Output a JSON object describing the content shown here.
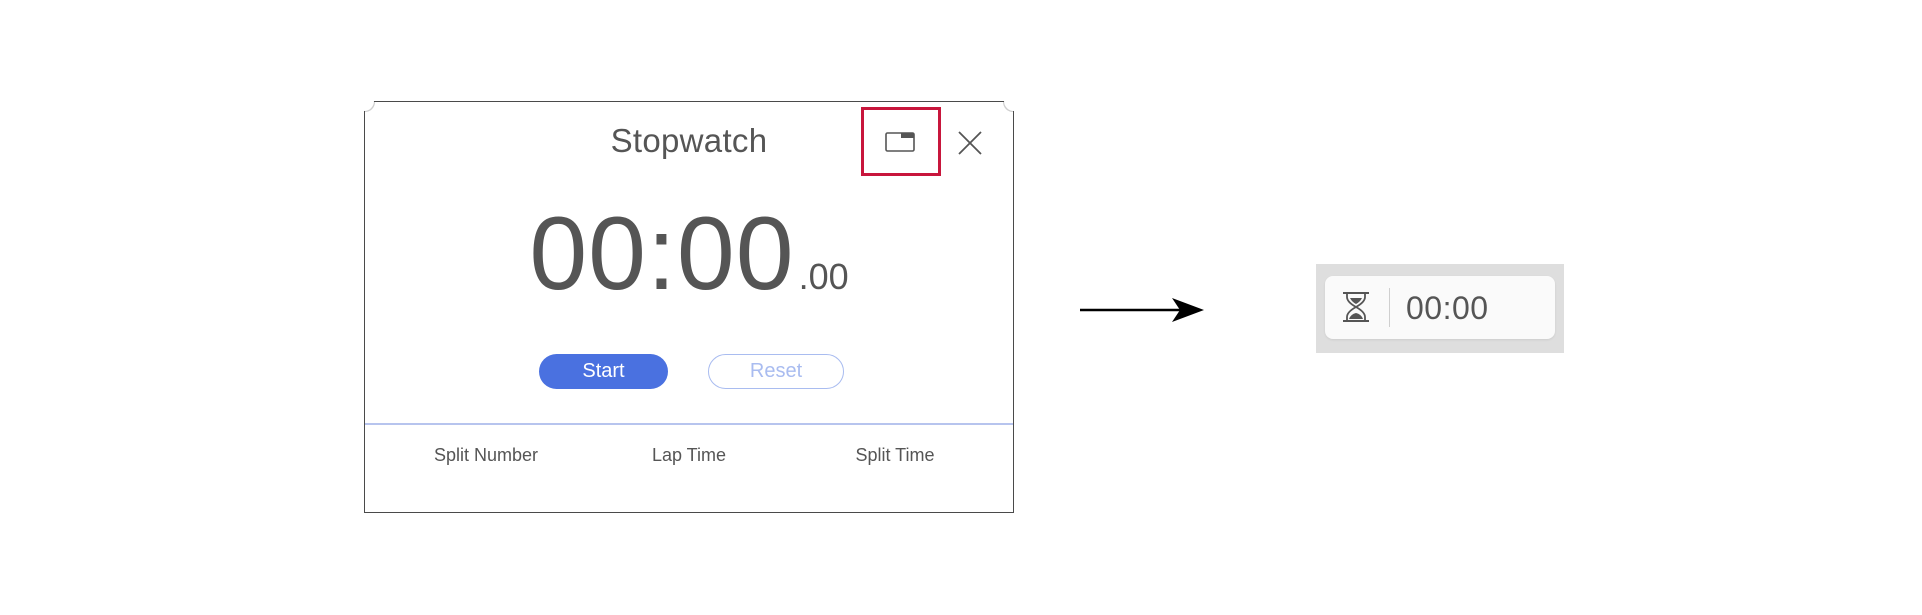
{
  "window": {
    "title": "Stopwatch",
    "time_main": "00:00",
    "time_fraction": ".00",
    "start_label": "Start",
    "reset_label": "Reset",
    "columns": [
      "Split Number",
      "Lap Time",
      "Split Time"
    ]
  },
  "icons": {
    "minimize": "minimize-to-widget-icon",
    "close": "close-icon",
    "widget": "hourglass-icon",
    "transition": "arrow-right"
  },
  "mini_widget": {
    "time": "00:00"
  },
  "colors": {
    "accent": "#4a71e0",
    "accent_light": "#a9bcf0",
    "highlight": "#c8163c",
    "text": "#555555"
  }
}
